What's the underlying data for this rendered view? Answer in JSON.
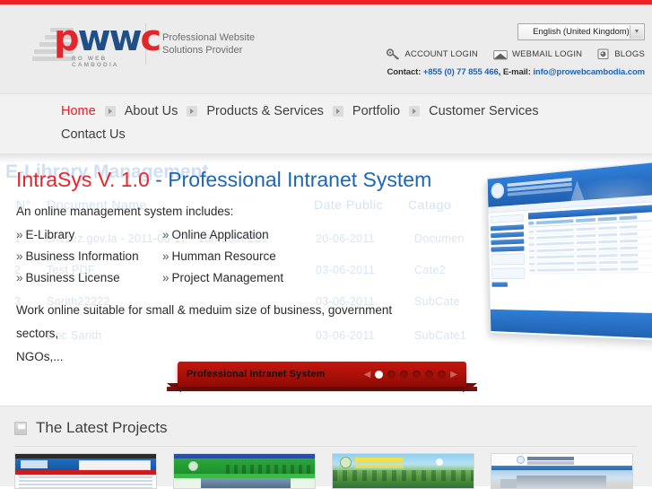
{
  "header": {
    "logo": {
      "letters_p": "p",
      "letters_w": "ww",
      "letters_c": "c",
      "subtext": "RO WEB CAMBODIA",
      "tagline_line1": "Professional Website",
      "tagline_line2": "Solutions Provider"
    },
    "language_selector": {
      "value": "English (United Kingdom)",
      "arrow": "▼"
    },
    "links": [
      {
        "label": "ACCOUNT LOGIN",
        "icon": "key-icon"
      },
      {
        "label": "WEBMAIL LOGIN",
        "icon": "envelope-icon"
      },
      {
        "label": "BLOGS",
        "icon": "blog-icon"
      }
    ],
    "contact": {
      "prefix": "Contact: ",
      "phone": "+855 (0) 77 855 466",
      "middle": ", E-mail: ",
      "email": "info@prowebcambodia.com"
    }
  },
  "nav": {
    "row1": [
      {
        "label": "Home",
        "active": true
      },
      {
        "label": "About Us",
        "active": false
      },
      {
        "label": "Products & Services",
        "active": false
      },
      {
        "label": "Portfolio",
        "active": false
      },
      {
        "label": "Customer Services",
        "active": false
      }
    ],
    "row2": [
      {
        "label": "Contact Us",
        "active": false
      }
    ]
  },
  "slider": {
    "title_red": "IntraSys V. 1.0",
    "title_dash": " - ",
    "title_blue": "Professional Intranet System",
    "subtitle": "An online management system includes:",
    "features_left": [
      "E-Library",
      "Business Information",
      "Business License"
    ],
    "features_right": [
      "Online Application",
      "Humman Resource",
      "Project Management"
    ],
    "chevron": "»",
    "footer_line1": "Work online suitable for small & meduim size of business, government sectors,",
    "footer_line2": "NGOs,...",
    "ghost": {
      "title": "E-Library Management",
      "col_num": "N°",
      "col_doc": "Document Name",
      "col_date": "Date Public",
      "col_cat": "Catago",
      "rows": [
        {
          "n": "1",
          "doc": "sncsez.gov.la - 2011-06-17 - 16h-20m-23s",
          "date": "20-06-2011",
          "cat": "Documen"
        },
        {
          "n": "2",
          "doc": "Test PDF",
          "date": "03-06-2011",
          "cat": "Cate2"
        },
        {
          "n": "3",
          "doc": "Sarith22222",
          "date": "03-06-2011",
          "cat": "SubCate"
        },
        {
          "n": "4",
          "doc": "Doc Sarith",
          "date": "03-06-2011",
          "cat": "SubCate1"
        }
      ]
    },
    "caption": {
      "label": "Professional Intranet System",
      "prev_arrow": "◀",
      "next_arrow": "▶",
      "dots": 6,
      "active_dot": 1
    }
  },
  "projects": {
    "title": "The Latest Projects",
    "icon": "book-icon",
    "thumbnails": [
      {
        "name": "project-thumb-1"
      },
      {
        "name": "project-thumb-2"
      },
      {
        "name": "project-thumb-3"
      },
      {
        "name": "project-thumb-4"
      }
    ]
  },
  "colors": {
    "red": "#ed2229",
    "brand_red": "#e3262c",
    "brand_blue": "#1f4f86",
    "link_blue": "#1c63b8",
    "ribbon_red": "#a81008"
  }
}
